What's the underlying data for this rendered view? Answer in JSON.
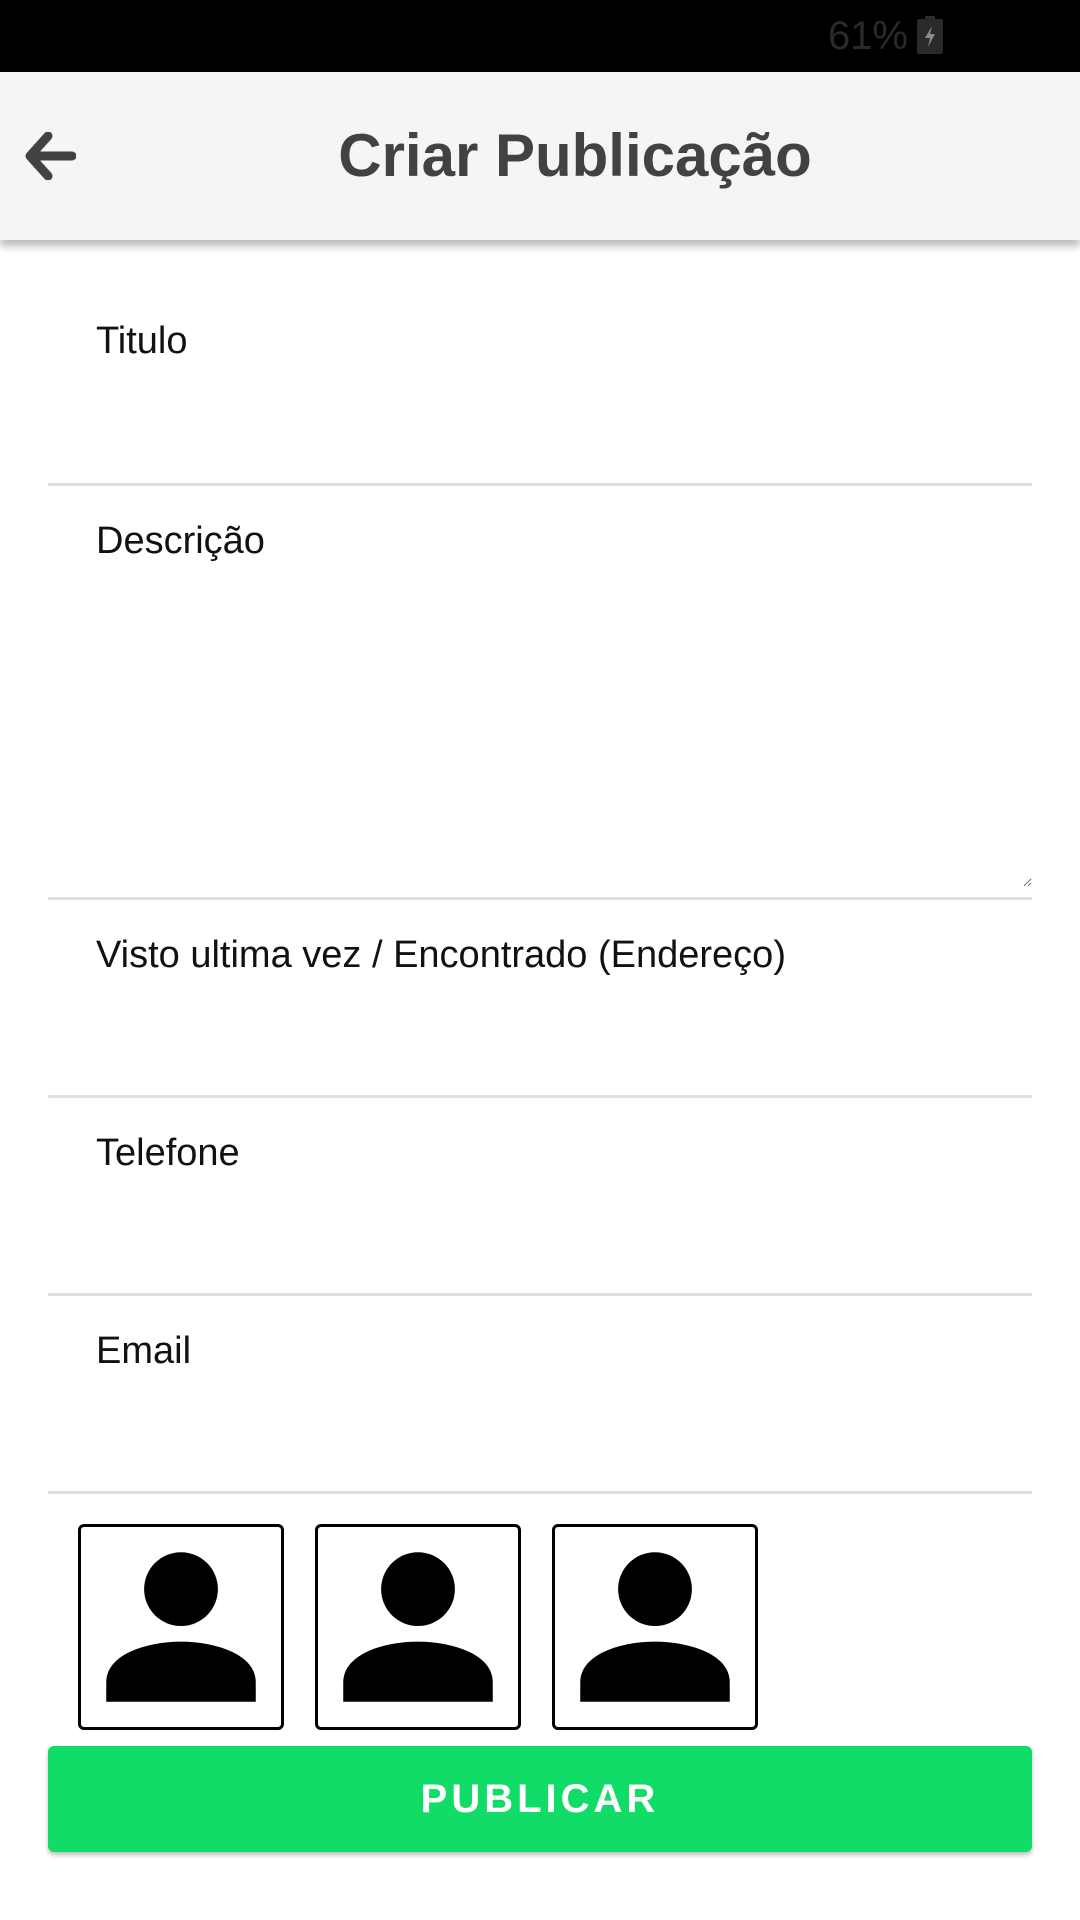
{
  "status_bar": {
    "battery_text": "61%",
    "battery_icon": "battery-charging-icon"
  },
  "app_bar": {
    "title": "Criar Publicação",
    "back_icon": "arrow-left-icon",
    "background": "#f5f5f5"
  },
  "form": {
    "fields": [
      {
        "label": "Titulo",
        "value": ""
      },
      {
        "label": "Descrição",
        "value": ""
      },
      {
        "label": "Visto ultima vez / Encontrado (Endereço)",
        "value": ""
      },
      {
        "label": "Telefone",
        "value": ""
      },
      {
        "label": "Email",
        "value": ""
      }
    ]
  },
  "photos": [
    {
      "icon": "person-placeholder-icon"
    },
    {
      "icon": "person-placeholder-icon"
    },
    {
      "icon": "person-placeholder-icon"
    }
  ],
  "publish_button": {
    "label": "PUBLICAR",
    "color": "#12dc68"
  }
}
